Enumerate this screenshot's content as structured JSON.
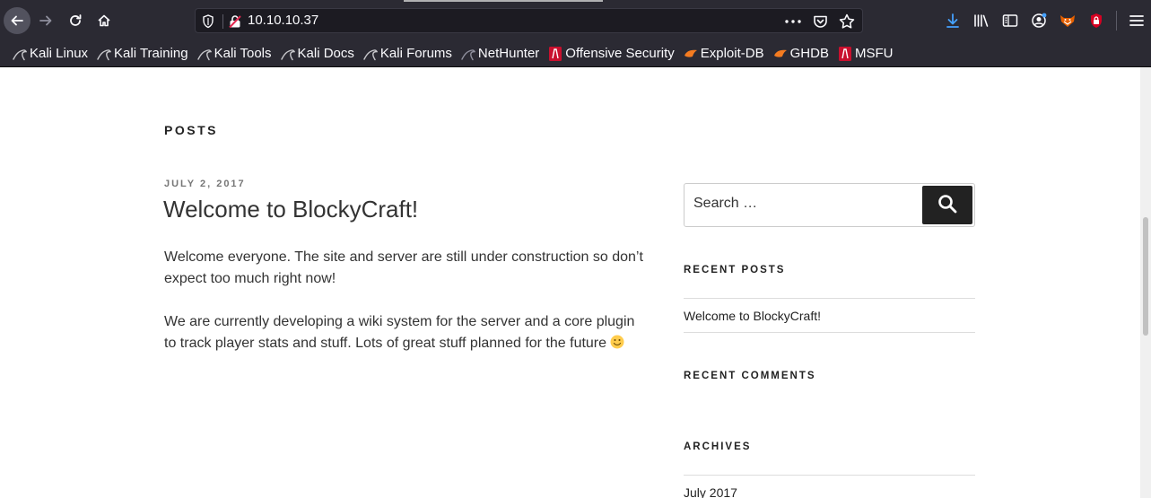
{
  "browser": {
    "url": "10.10.10.37",
    "colors": {
      "chrome": "#2b2a33",
      "urlbar": "#1c1b22",
      "download_accent": "#45a1ff"
    },
    "icons": {
      "back": "back-arrow-icon",
      "forward": "forward-arrow-icon",
      "reload": "reload-icon",
      "home": "home-icon",
      "more": "more-dots-icon",
      "pocket": "pocket-icon",
      "bookmark_star": "star-icon",
      "downloads": "download-icon",
      "library": "library-icon",
      "sidebar": "sidebar-icon",
      "account": "account-icon",
      "foxyproxy": "foxyproxy-icon",
      "extension": "lock-extension-icon",
      "menu": "hamburger-menu-icon"
    }
  },
  "bookmarks": [
    {
      "label": "Kali Linux",
      "icon": "kali-dragon-icon"
    },
    {
      "label": "Kali Training",
      "icon": "kali-dragon-icon"
    },
    {
      "label": "Kali Tools",
      "icon": "kali-dragon-icon"
    },
    {
      "label": "Kali Docs",
      "icon": "kali-dragon-icon"
    },
    {
      "label": "Kali Forums",
      "icon": "kali-dragon-icon"
    },
    {
      "label": "NetHunter",
      "icon": "kali-dragon-icon"
    },
    {
      "label": "Offensive Security",
      "icon": "offsec-icon"
    },
    {
      "label": "Exploit-DB",
      "icon": "exploitdb-icon"
    },
    {
      "label": "GHDB",
      "icon": "exploitdb-icon"
    },
    {
      "label": "MSFU",
      "icon": "offsec-icon"
    }
  ],
  "main": {
    "section_heading": "POSTS",
    "post": {
      "date": "JULY 2, 2017",
      "title": "Welcome to BlockyCraft!",
      "paragraphs": [
        "Welcome everyone. The site and server are still under construction so don’t expect too much right now!",
        "We are currently developing a wiki system for the server and a core plugin to track player stats and stuff. Lots of great stuff planned for the future"
      ]
    }
  },
  "sidebar": {
    "search": {
      "placeholder": "Search …",
      "button_icon": "search-icon"
    },
    "recent_posts": {
      "title": "RECENT POSTS",
      "items": [
        "Welcome to BlockyCraft!"
      ]
    },
    "recent_comments": {
      "title": "RECENT COMMENTS"
    },
    "archives": {
      "title": "ARCHIVES",
      "items": [
        "July 2017"
      ]
    }
  }
}
